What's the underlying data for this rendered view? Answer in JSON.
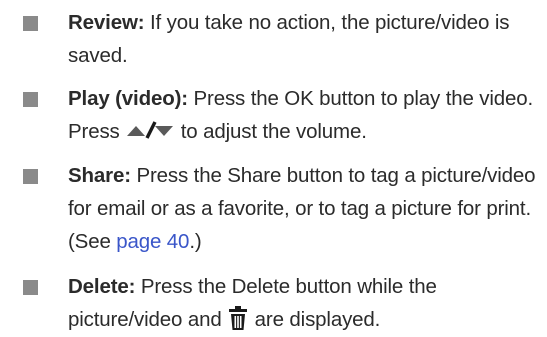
{
  "items": [
    {
      "term": "Review:",
      "text": " If you take no action, the picture/video is saved."
    },
    {
      "term": "Play (video):",
      "text_before": " Press the OK button to play the video. Press ",
      "icon": "up-down-arrows-icon",
      "text_after": " to adjust the volume."
    },
    {
      "term": "Share:",
      "text_before": " Press the Share button to tag a picture/video for email or as a favorite, or to tag a picture for print. (See ",
      "link": "page 40",
      "text_after": ".)"
    },
    {
      "term": "Delete:",
      "text_before": " Press the Delete button while the picture/video and ",
      "icon": "trash-can-icon",
      "text_after": " are displayed."
    }
  ],
  "colors": {
    "text": "#2b2b2b",
    "bullet": "#8a8a8a",
    "link": "#3a56c9"
  }
}
